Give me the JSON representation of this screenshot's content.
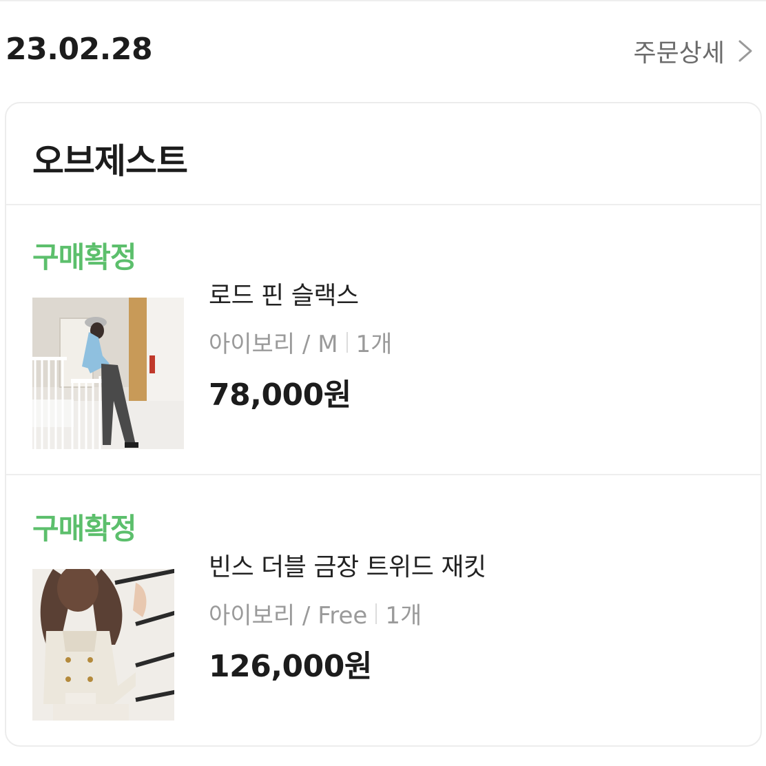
{
  "order": {
    "date": "23.02.28",
    "detail_label": "주문상세"
  },
  "store": {
    "name": "오브제스트"
  },
  "items": [
    {
      "status": "구매확정",
      "name": "로드 핀 슬랙스",
      "option": "아이보리 / M",
      "quantity": "1개",
      "price": "78,000원"
    },
    {
      "status": "구매확정",
      "name": "빈스 더블 금장 트위드 재킷",
      "option": "아이보리 / Free",
      "quantity": "1개",
      "price": "126,000원"
    }
  ],
  "colors": {
    "status_green": "#5cbf6c",
    "text_dark": "#1c1c1c",
    "text_muted": "#9a9a9a",
    "border": "#ececec"
  },
  "icons": {
    "detail": "chevron-right-icon"
  }
}
